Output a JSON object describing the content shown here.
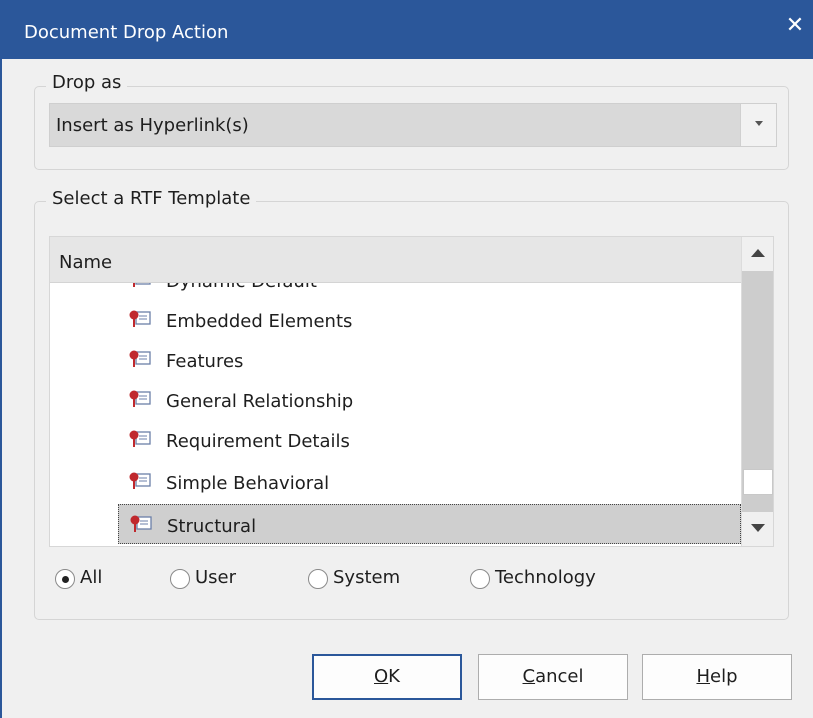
{
  "window": {
    "title": "Document Drop Action",
    "close_glyph": "✕"
  },
  "drop_as": {
    "legend": "Drop as",
    "selected": "Insert as Hyperlink(s)"
  },
  "template": {
    "legend": "Select a RTF Template",
    "column_header": "Name",
    "items": [
      {
        "label": "Dynamic Default",
        "icon": "template-icon"
      },
      {
        "label": "Embedded Elements",
        "icon": "template-icon"
      },
      {
        "label": "Features",
        "icon": "template-icon"
      },
      {
        "label": "General Relationship",
        "icon": "template-icon"
      },
      {
        "label": "Requirement Details",
        "icon": "template-icon"
      },
      {
        "label": "Simple Behavioral",
        "icon": "template-icon"
      },
      {
        "label": "Structural",
        "icon": "template-icon",
        "selected": true
      }
    ]
  },
  "filters": [
    {
      "label": "All",
      "checked": true
    },
    {
      "label": "User",
      "checked": false
    },
    {
      "label": "System",
      "checked": false
    },
    {
      "label": "Technology",
      "checked": false
    }
  ],
  "buttons": {
    "ok": {
      "accel": "O",
      "rest": "K"
    },
    "cancel": {
      "accel": "C",
      "rest": "ancel"
    },
    "help": {
      "accel": "H",
      "rest": "elp"
    }
  },
  "colors": {
    "titlebar": "#2b579a",
    "selection": "#cfcfcf",
    "icon_red": "#c0282d"
  }
}
